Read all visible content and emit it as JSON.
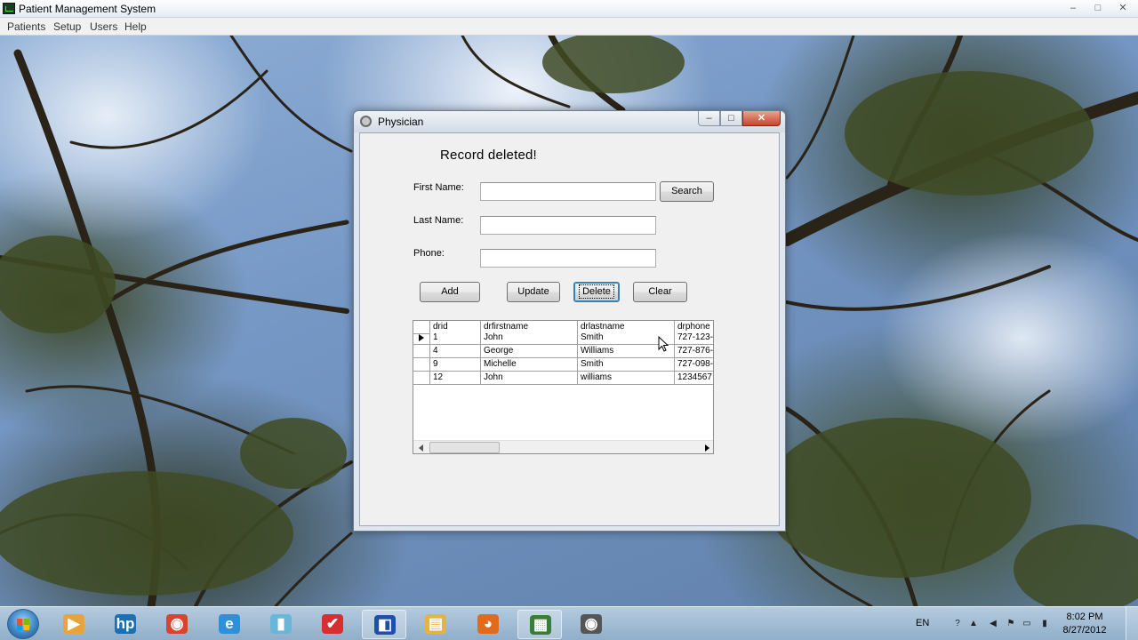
{
  "app": {
    "title": "Patient Management System",
    "window_controls": {
      "minimize": "–",
      "maximize": "□",
      "close": "✕"
    }
  },
  "menu": {
    "items": [
      "Patients",
      "Setup",
      "Users",
      "Help"
    ]
  },
  "physician_window": {
    "title": "Physician",
    "controls": {
      "minimize": "–",
      "maximize": "□",
      "close": "✕"
    },
    "status_message": "Record deleted!",
    "labels": {
      "first_name": "First Name:",
      "last_name": "Last Name:",
      "phone": "Phone:"
    },
    "fields": {
      "first_name": "",
      "last_name": "",
      "phone": ""
    },
    "buttons": {
      "search": "Search",
      "add": "Add",
      "update": "Update",
      "delete": "Delete",
      "clear": "Clear"
    },
    "grid": {
      "columns": [
        "drid",
        "drfirstname",
        "drlastname",
        "drphone"
      ],
      "rows": [
        [
          "1",
          "John",
          "Smith",
          "727-123-"
        ],
        [
          "4",
          "George",
          "Williams",
          "727-876-"
        ],
        [
          "9",
          "Michelle",
          "Smith",
          "727-098-"
        ],
        [
          "12",
          "John",
          "williams",
          "1234567"
        ]
      ],
      "selected_row_index": 0
    }
  },
  "taskbar": {
    "items": [
      {
        "icon": "media-player-icon",
        "glyph": "▶",
        "color": "#e8a43b"
      },
      {
        "icon": "hp-icon",
        "glyph": "hp",
        "color": "#1b6fb3"
      },
      {
        "icon": "chrome-icon",
        "glyph": "◉",
        "color": "#d9442f"
      },
      {
        "icon": "internet-explorer-icon",
        "glyph": "e",
        "color": "#2f8fd9"
      },
      {
        "icon": "app-cube-icon",
        "glyph": "▮",
        "color": "#6ab6d9"
      },
      {
        "icon": "checkmark-app-icon",
        "glyph": "✔",
        "color": "#d62f2f"
      },
      {
        "icon": "visual-studio-icon",
        "glyph": "◧",
        "color": "#1f4fa8"
      },
      {
        "icon": "folder-icon",
        "glyph": "▤",
        "color": "#e2b444"
      },
      {
        "icon": "firefox-icon",
        "glyph": "◕",
        "color": "#e06b1f"
      },
      {
        "icon": "patient-management-app-icon",
        "glyph": "▦",
        "color": "#3a7d3a"
      },
      {
        "icon": "webcam-eye-icon",
        "glyph": "◉",
        "color": "#555555"
      }
    ],
    "active_item_indices": [
      6,
      9
    ],
    "language": "EN",
    "clock": {
      "time": "8:02 PM",
      "date": "8/27/2012"
    }
  }
}
